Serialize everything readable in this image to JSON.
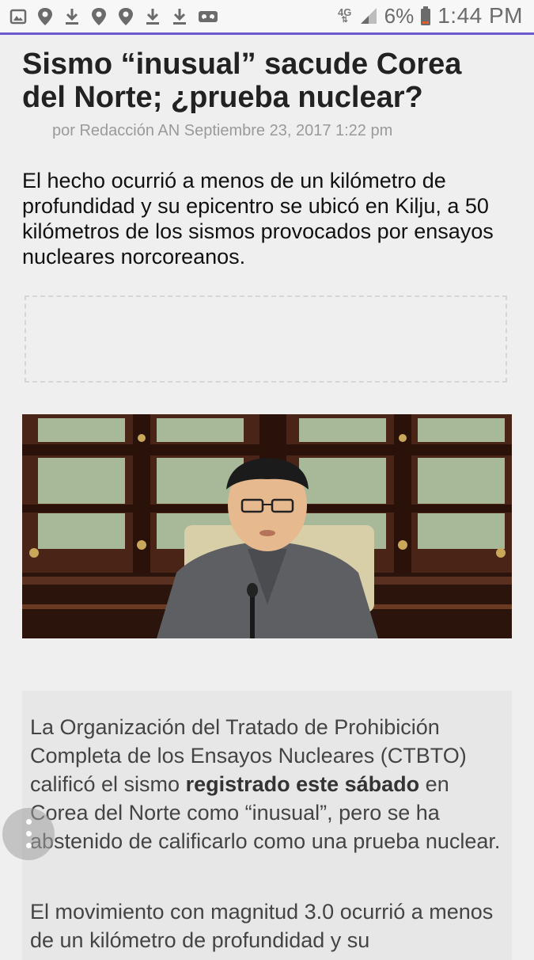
{
  "status_bar": {
    "notification_icons": [
      "gallery-icon",
      "location-pin-icon",
      "download-icon",
      "location-pin-icon",
      "location-pin-icon",
      "download-icon",
      "download-icon",
      "voicemail-icon"
    ],
    "network": "4G",
    "battery_percent": "6%",
    "time": "1:44 PM",
    "accent_color": "#6a5acd"
  },
  "article": {
    "title": "Sismo “inusual” sacude Corea del Norte; ¿prueba nuclear?",
    "byline": "por Redacción AN Septiembre 23, 2017 1:22 pm",
    "lead": "El hecho ocurrió a menos de un kilómetro de profundidad y su epicentro se ubicó en Kilju, a 50 kilómetros de los sismos provocados por ensayos nucleares norcoreanos.",
    "paragraph1": {
      "before": "La Organización del Tratado de Prohibición Completa de los Ensayos Nucleares (CTBTO) calificó el sismo ",
      "bold": "registrado este sábado",
      "after": " en Corea del Norte como “inusual”, pero se ha abstenido de calificarlo como una prueba nuclear."
    },
    "paragraph2": "El movimiento con magnitud 3.0 ocurrió a menos de un kilómetro de profundidad y su"
  }
}
